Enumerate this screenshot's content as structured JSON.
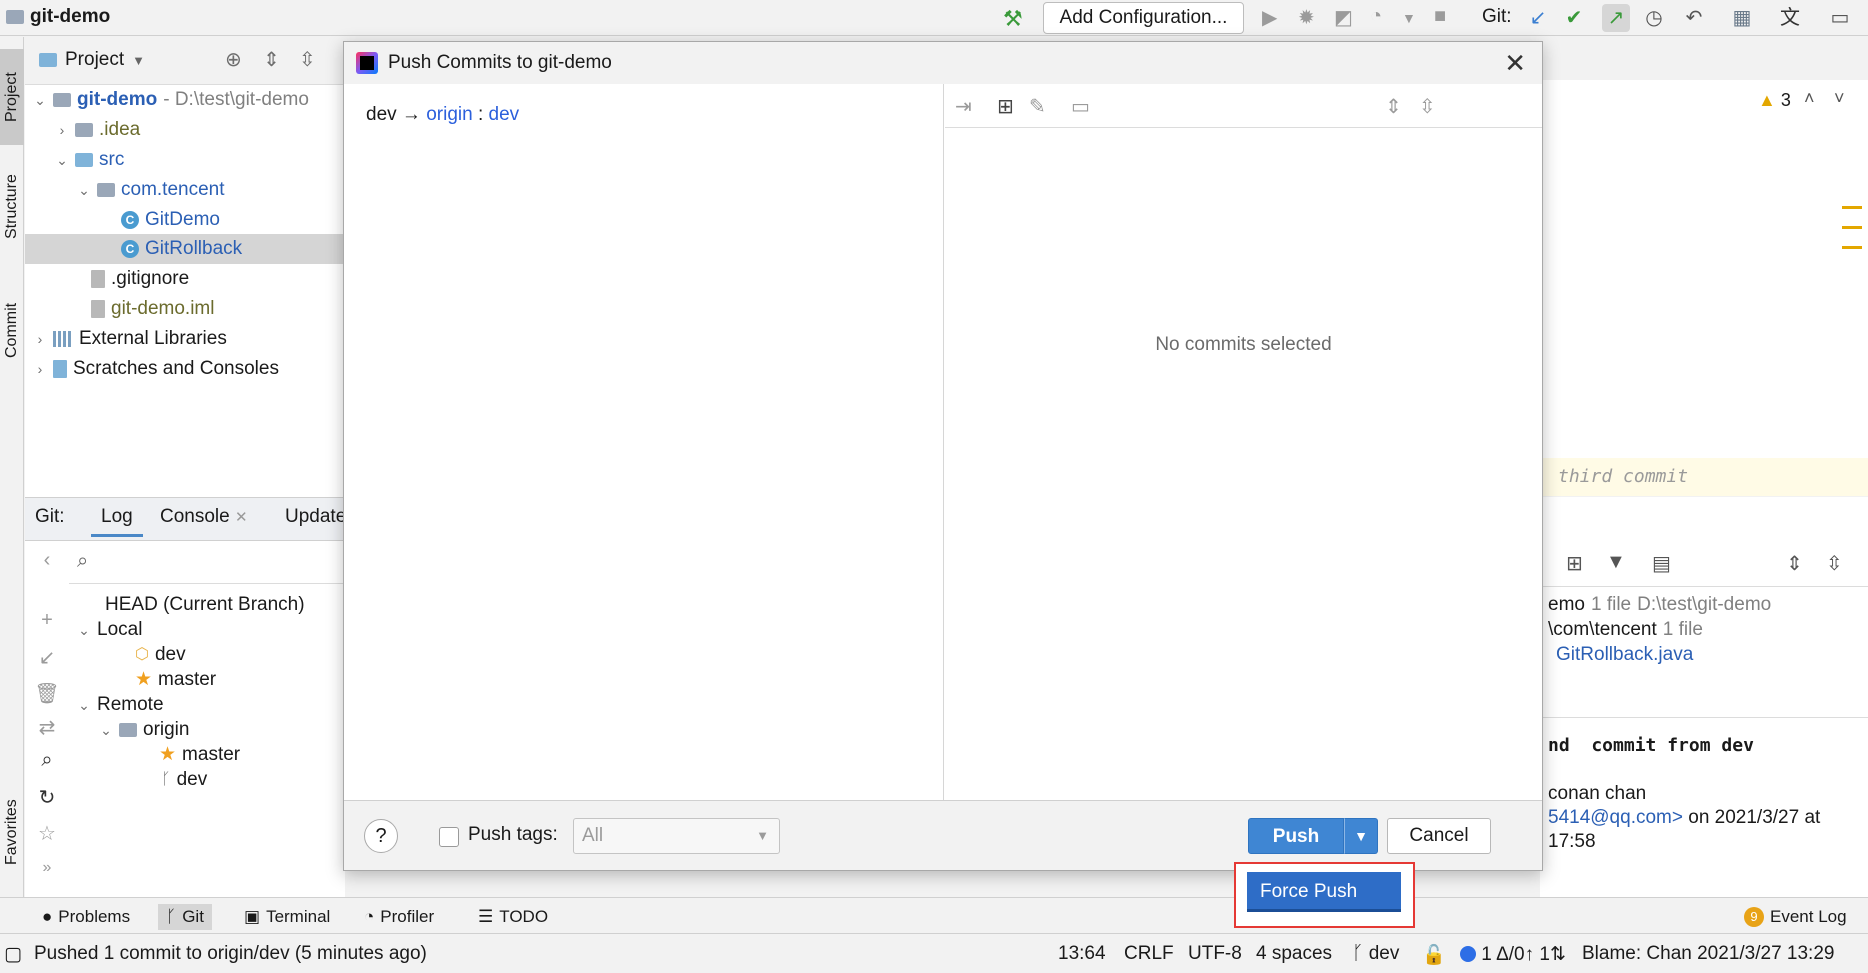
{
  "window": {
    "project_name": "git-demo"
  },
  "toolbar": {
    "add_configuration": "Add Configuration...",
    "git_label": "Git:"
  },
  "left_strip": {
    "project_tab": "Project",
    "structure_tab": "Structure",
    "commit_tab": "Commit",
    "favorites_tab": "Favorites"
  },
  "project_panel": {
    "title": "Project",
    "tree": [
      {
        "label": "git-demo",
        "extra": " - D:\\test\\git-demo"
      },
      {
        "label": ".idea"
      },
      {
        "label": "src"
      },
      {
        "label": "com.tencent"
      },
      {
        "label": "GitDemo"
      },
      {
        "label": "GitRollback"
      },
      {
        "label": ".gitignore"
      },
      {
        "label": "git-demo.iml"
      },
      {
        "label": "External Libraries"
      },
      {
        "label": "Scratches and Consoles"
      }
    ]
  },
  "git_panel": {
    "git_label": "Git:",
    "tabs": [
      "Log",
      "Console",
      "Update"
    ],
    "branches": {
      "head": "HEAD (Current Branch)",
      "local": "Local",
      "local_dev": "dev",
      "local_master": "master",
      "remote": "Remote",
      "origin": "origin",
      "origin_master": "master",
      "origin_dev": "dev"
    }
  },
  "editor_right": {
    "warnings": "3",
    "commit_hint": "third commit"
  },
  "log_details": {
    "line1_name": "emo",
    "line1_count": "1 file",
    "line1_path": "D:\\test\\git-demo",
    "line2_name": "\\com\\tencent",
    "line2_count": "1 file",
    "line3_file": "GitRollback.java",
    "commit_msg": "nd  commit from dev",
    "author": "conan chan",
    "email": "5414@qq.com>",
    "date": " on 2021/3/27 at",
    "time": "17:58"
  },
  "dialog": {
    "title": "Push Commits to git-demo",
    "local_branch": "dev",
    "arrow": "→",
    "remote": "origin",
    "separator": " : ",
    "remote_branch": "dev",
    "no_commits": "No commits selected",
    "push_tags_label": "Push tags:",
    "tags_value": "All",
    "push_button": "Push",
    "cancel_button": "Cancel",
    "help": "?"
  },
  "popup": {
    "force_push": "Force Push"
  },
  "tool_windows": [
    "Problems",
    "Git",
    "Terminal",
    "Profiler",
    "TODO",
    "Event Log"
  ],
  "event_log_count": "9",
  "status": {
    "message": "Pushed 1 commit to origin/dev (5 minutes ago)",
    "position": "13:64",
    "line_sep": "CRLF",
    "encoding": "UTF-8",
    "indent": "4 spaces",
    "branch": "dev",
    "changes": "1 Δ/0↑ 1⇅",
    "blame": "Blame: Chan 2021/3/27 13:29"
  },
  "colors": {
    "accent": "#3f86d3",
    "highlight_box": "#e53935",
    "link": "#2b5fdc"
  }
}
